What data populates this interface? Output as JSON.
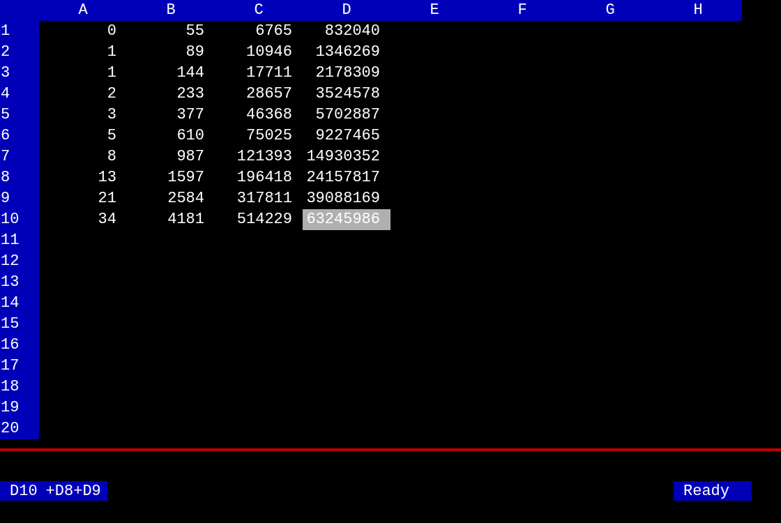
{
  "columns": [
    "A",
    "B",
    "C",
    "D",
    "E",
    "F",
    "G",
    "H"
  ],
  "rows": [
    {
      "label": "1",
      "cells": [
        {
          "text": "0",
          "selected": false
        },
        {
          "text": "55",
          "selected": false
        },
        {
          "text": "6765",
          "selected": false
        },
        {
          "text": "832040",
          "selected": false
        }
      ]
    },
    {
      "label": "2",
      "cells": [
        {
          "text": "1",
          "selected": false
        },
        {
          "text": "89",
          "selected": false
        },
        {
          "text": "10946",
          "selected": false
        },
        {
          "text": "1346269",
          "selected": false
        }
      ]
    },
    {
      "label": "3",
      "cells": [
        {
          "text": "1",
          "selected": false
        },
        {
          "text": "144",
          "selected": false
        },
        {
          "text": "17711",
          "selected": false
        },
        {
          "text": "2178309",
          "selected": false
        }
      ]
    },
    {
      "label": "4",
      "cells": [
        {
          "text": "2",
          "selected": false
        },
        {
          "text": "233",
          "selected": false
        },
        {
          "text": "28657",
          "selected": false
        },
        {
          "text": "3524578",
          "selected": false
        }
      ]
    },
    {
      "label": "5",
      "cells": [
        {
          "text": "3",
          "selected": false
        },
        {
          "text": "377",
          "selected": false
        },
        {
          "text": "46368",
          "selected": false
        },
        {
          "text": "5702887",
          "selected": false
        }
      ]
    },
    {
      "label": "6",
      "cells": [
        {
          "text": "5",
          "selected": false
        },
        {
          "text": "610",
          "selected": false
        },
        {
          "text": "75025",
          "selected": false
        },
        {
          "text": "9227465",
          "selected": false
        }
      ]
    },
    {
      "label": "7",
      "cells": [
        {
          "text": "8",
          "selected": false
        },
        {
          "text": "987",
          "selected": false
        },
        {
          "text": "121393",
          "selected": false
        },
        {
          "text": "14930352",
          "selected": false
        }
      ]
    },
    {
      "label": "8",
      "cells": [
        {
          "text": "13",
          "selected": false
        },
        {
          "text": "1597",
          "selected": false
        },
        {
          "text": "196418",
          "selected": false
        },
        {
          "text": "24157817",
          "selected": false
        }
      ]
    },
    {
      "label": "9",
      "cells": [
        {
          "text": "21",
          "selected": false
        },
        {
          "text": "2584",
          "selected": false
        },
        {
          "text": "317811",
          "selected": false
        },
        {
          "text": "39088169",
          "selected": false
        }
      ]
    },
    {
      "label": "10",
      "cells": [
        {
          "text": "34",
          "selected": false
        },
        {
          "text": "4181",
          "selected": false
        },
        {
          "text": "514229",
          "selected": false
        },
        {
          "text": "63245986",
          "selected": true
        }
      ]
    },
    {
      "label": "11"
    },
    {
      "label": "12"
    },
    {
      "label": "13"
    },
    {
      "label": "14"
    },
    {
      "label": "15"
    },
    {
      "label": "16"
    },
    {
      "label": "17"
    },
    {
      "label": "18"
    },
    {
      "label": "19"
    },
    {
      "label": "20"
    }
  ],
  "status_bar": {
    "cell_ref": "D10",
    "formula": "+D8+D9",
    "mode": "Ready"
  }
}
